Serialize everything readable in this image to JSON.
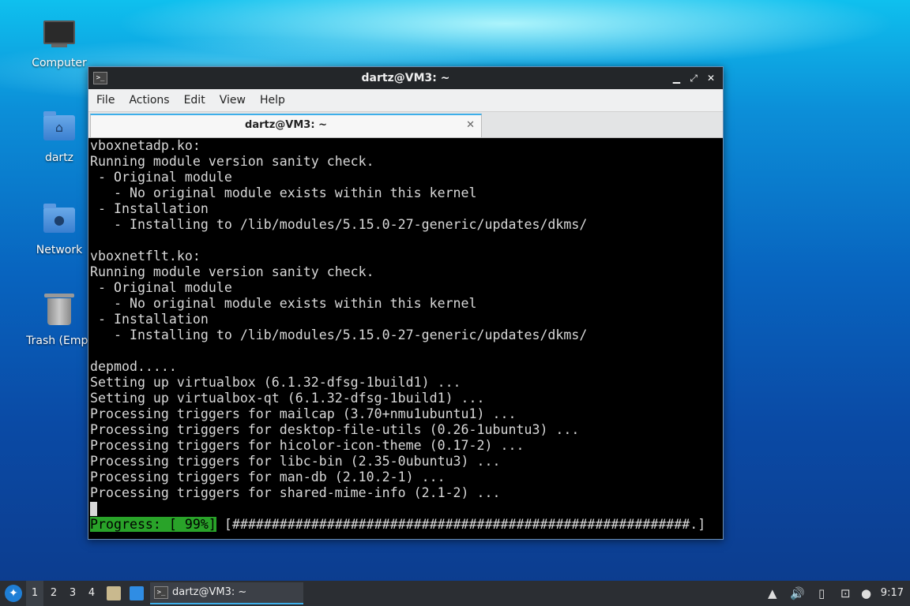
{
  "desktop": {
    "icons": [
      {
        "label": "Computer"
      },
      {
        "label": "dartz"
      },
      {
        "label": "Network"
      },
      {
        "label": "Trash (Empt"
      }
    ]
  },
  "window": {
    "title": "dartz@VM3: ~",
    "controls": {
      "minimize": "▁",
      "maximize": "⤢",
      "close": "✕"
    },
    "menu": [
      "File",
      "Actions",
      "Edit",
      "View",
      "Help"
    ],
    "tab": {
      "title": "dartz@VM3: ~",
      "close": "✕"
    }
  },
  "terminal": {
    "lines": [
      "vboxnetadp.ko:",
      "Running module version sanity check.",
      " - Original module",
      "   - No original module exists within this kernel",
      " - Installation",
      "   - Installing to /lib/modules/5.15.0-27-generic/updates/dkms/",
      "",
      "vboxnetflt.ko:",
      "Running module version sanity check.",
      " - Original module",
      "   - No original module exists within this kernel",
      " - Installation",
      "   - Installing to /lib/modules/5.15.0-27-generic/updates/dkms/",
      "",
      "depmod.....",
      "Setting up virtualbox (6.1.32-dfsg-1build1) ...",
      "Setting up virtualbox-qt (6.1.32-dfsg-1build1) ...",
      "Processing triggers for mailcap (3.70+nmu1ubuntu1) ...",
      "Processing triggers for desktop-file-utils (0.26-1ubuntu3) ...",
      "Processing triggers for hicolor-icon-theme (0.17-2) ...",
      "Processing triggers for libc-bin (2.35-0ubuntu3) ...",
      "Processing triggers for man-db (2.10.2-1) ...",
      "Processing triggers for shared-mime-info (2.1-2) ..."
    ],
    "progress_label": "Progress: [ 99%]",
    "progress_bar": " [##########################################################.]"
  },
  "taskbar": {
    "workspaces": [
      "1",
      "2",
      "3",
      "4"
    ],
    "task_label": "dartz@VM3: ~",
    "clock": "9:17"
  }
}
